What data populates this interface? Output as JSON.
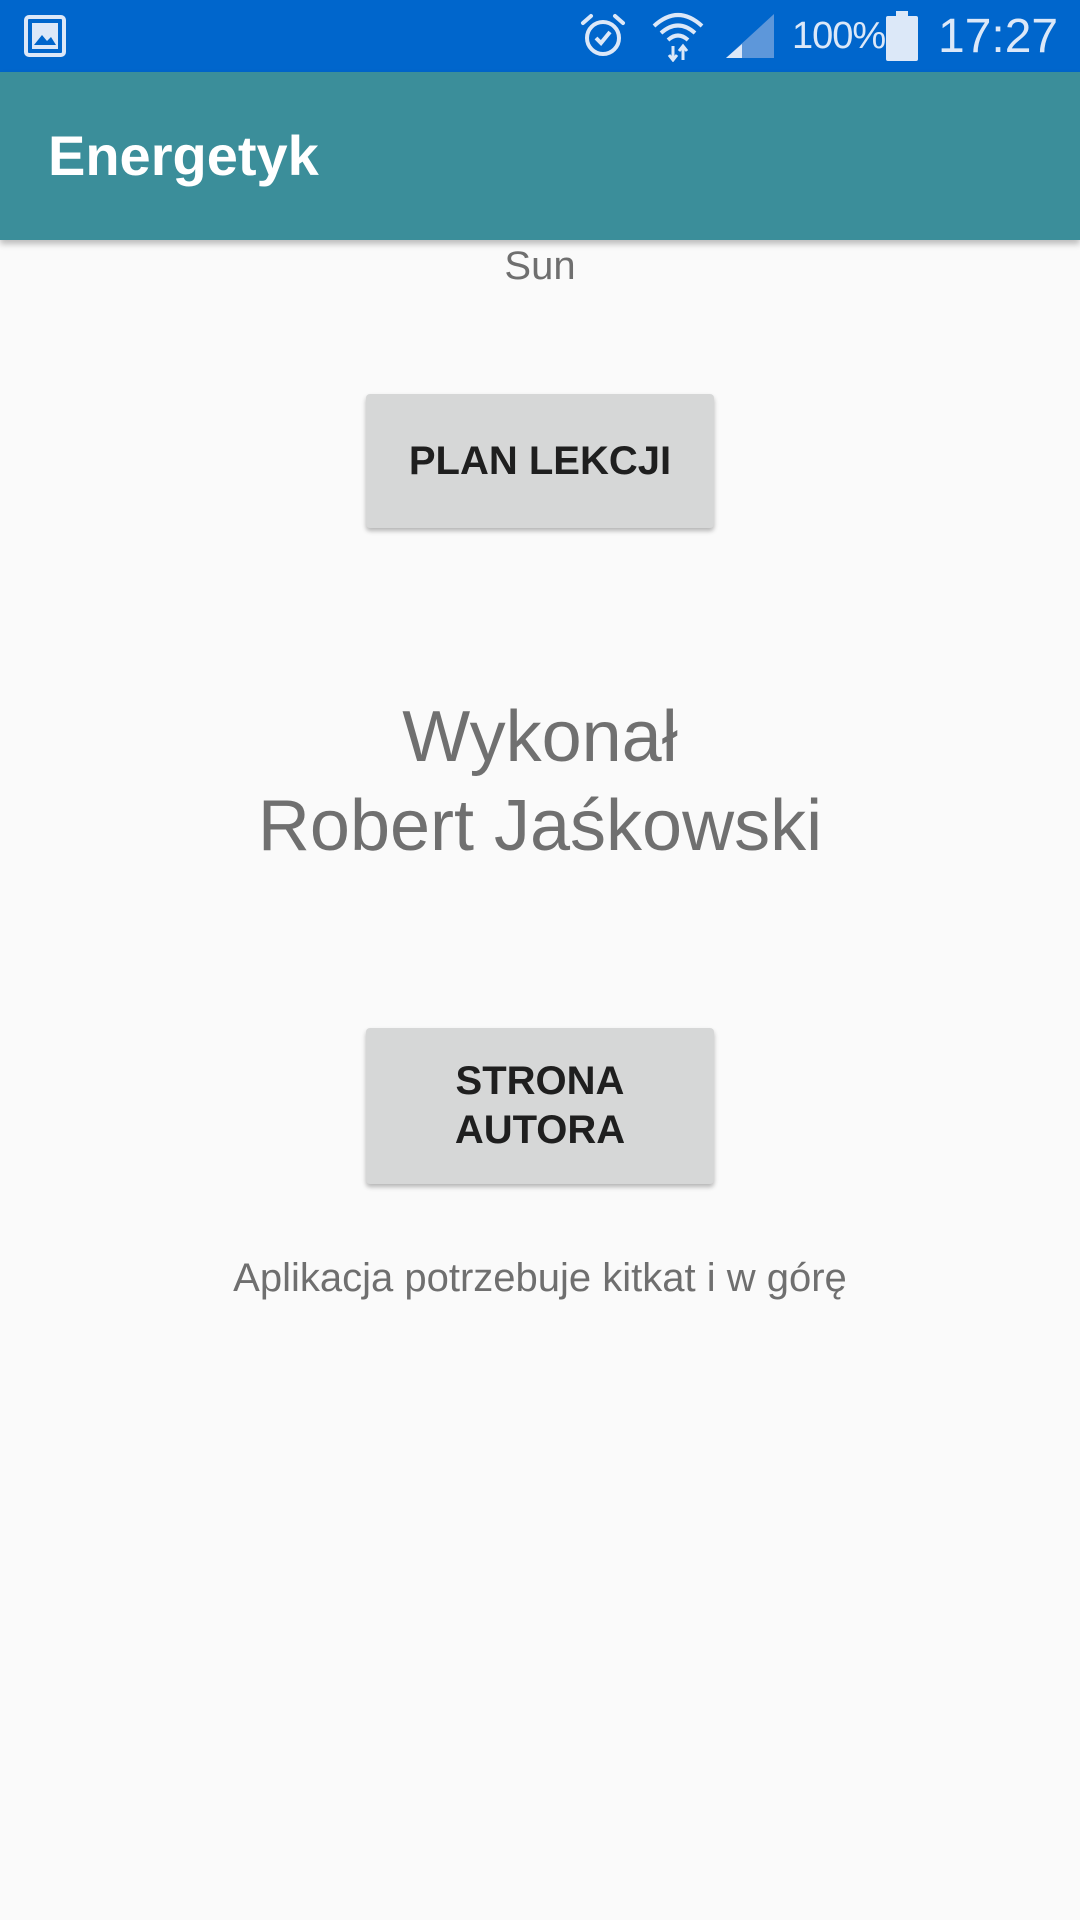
{
  "status_bar": {
    "notification_icon": "gallery-icon",
    "alarm_icon": "alarm-icon",
    "wifi_icon": "wifi-icon",
    "signal_icon": "signal-icon",
    "battery_text": "100%",
    "battery_icon": "battery-full-icon",
    "battery_level": 1.0,
    "time": "17:27",
    "background_color": "#0066cc"
  },
  "app_bar": {
    "title": "Energetyk",
    "background_color": "#3b8e9a"
  },
  "main": {
    "day": "Sun",
    "plan_button": "PLAN LEKCJI",
    "credit_line1": "Wykonał",
    "credit_line2": "Robert Jaśkowski",
    "author_button_line1": "STRONA",
    "author_button_line2": "AUTORA",
    "requirement": "Aplikacja potrzebuje kitkat i w górę"
  }
}
